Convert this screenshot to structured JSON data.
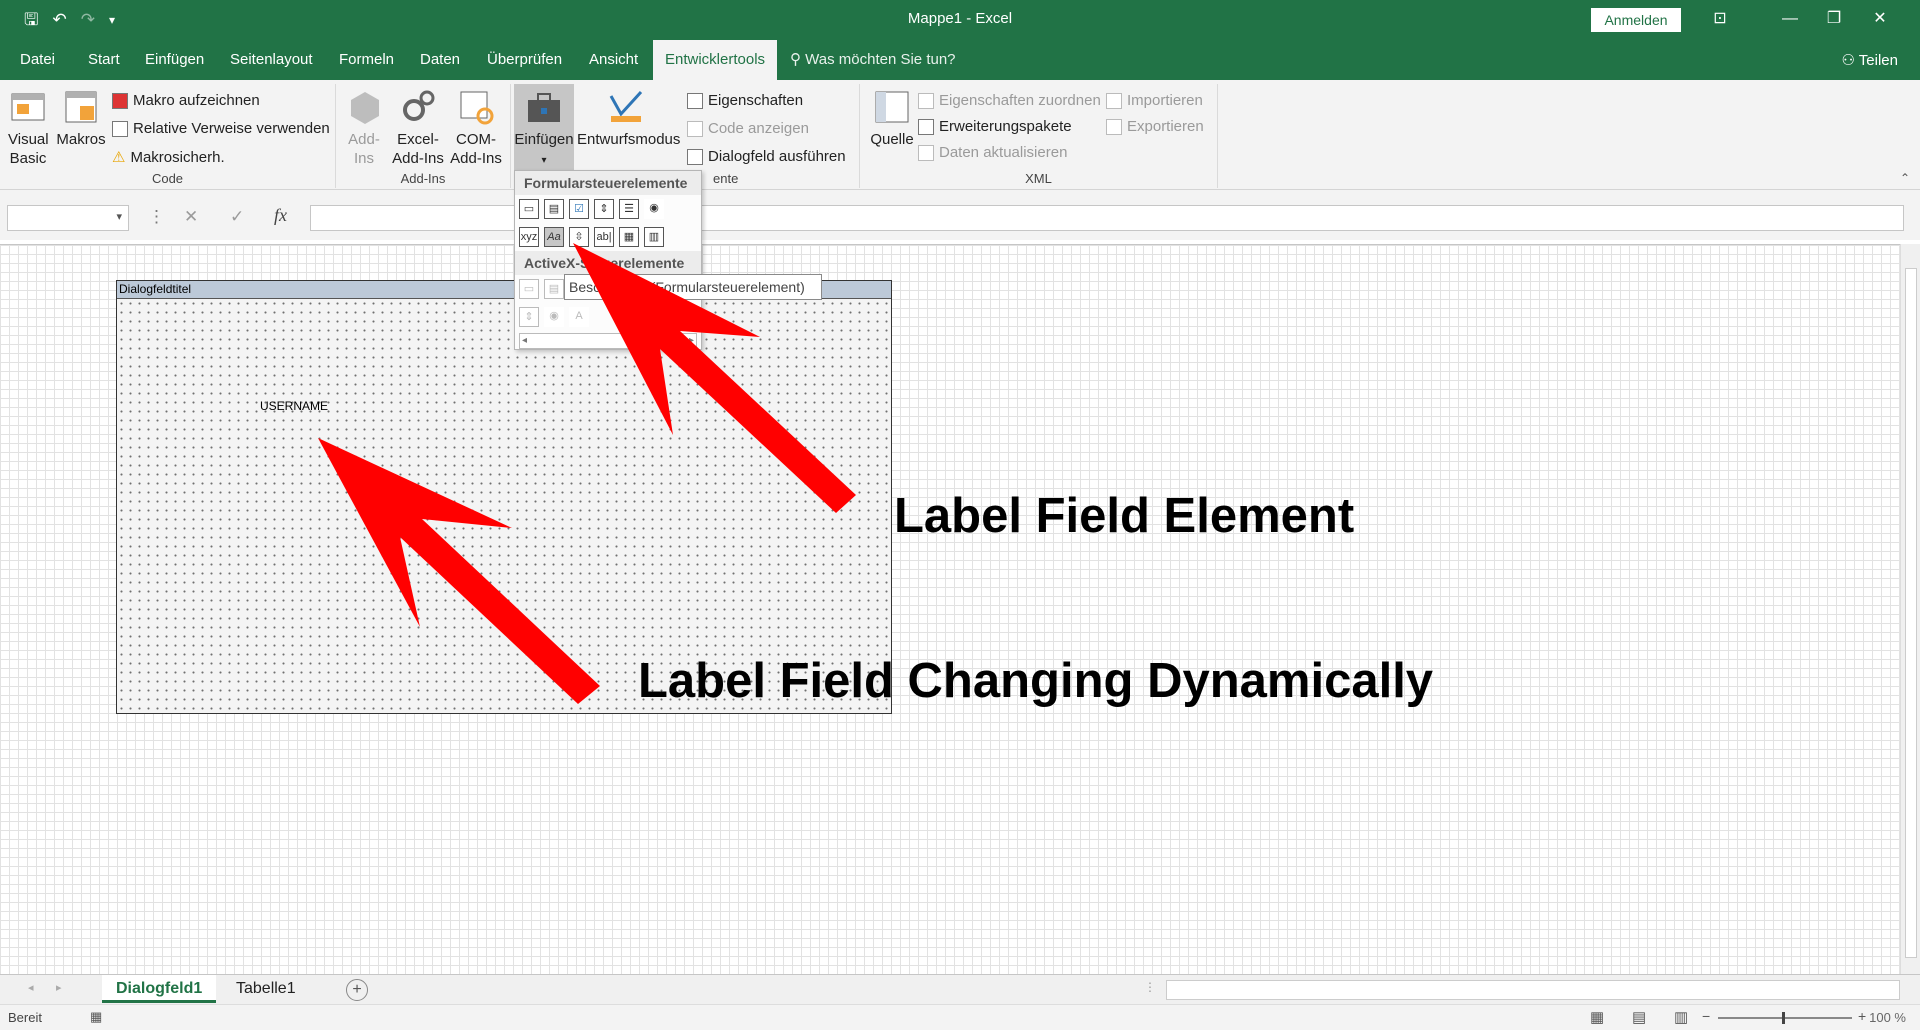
{
  "app": {
    "window_title": "Mappe1  -  Excel",
    "sign_in": "Anmelden",
    "share": "Teilen",
    "tell_me": "Was möchten Sie tun?",
    "accent_color": "#217346"
  },
  "tabs": [
    "Datei",
    "Start",
    "Einfügen",
    "Seitenlayout",
    "Formeln",
    "Daten",
    "Überprüfen",
    "Ansicht",
    "Entwicklertools"
  ],
  "active_tab": "Entwicklertools",
  "ribbon": {
    "code": {
      "label": "Code",
      "visual_basic": "Visual\nBasic",
      "makros": "Makros",
      "record": "Makro aufzeichnen",
      "relative": "Relative Verweise verwenden",
      "security": "Makrosicherh."
    },
    "addins": {
      "label": "Add-Ins",
      "addins": "Add-\nIns",
      "excel_addins": "Excel-\nAdd-Ins",
      "com_addins": "COM-\nAdd-Ins"
    },
    "controls": {
      "label_suffix": "ente",
      "insert": "Einfügen",
      "design_mode": "Entwurfsmodus",
      "properties": "Eigenschaften",
      "view_code": "Code anzeigen",
      "run_dialog": "Dialogfeld ausführen"
    },
    "xml": {
      "label": "XML",
      "source": "Quelle",
      "map_properties": "Eigenschaften zuordnen",
      "expansion_packs": "Erweiterungspakete",
      "refresh": "Daten aktualisieren",
      "import": "Importieren",
      "export": "Exportieren"
    }
  },
  "dropdown": {
    "form_controls_header": "Formularsteuerelemente",
    "activex_header": "ActiveX-Steuerelemente",
    "tooltip": "Beschriftung (Formularsteuerelement)"
  },
  "dialog": {
    "title": "Dialogfeldtitel",
    "label": "USERNAME"
  },
  "annotations": {
    "label_field_element": "Label Field Element",
    "label_field_changing": "Label Field Changing Dynamically",
    "arrow_color": "#ff0000"
  },
  "sheets": [
    "Dialogfeld1",
    "Tabelle1"
  ],
  "active_sheet": "Dialogfeld1",
  "status": {
    "ready": "Bereit",
    "zoom": "100 %"
  }
}
